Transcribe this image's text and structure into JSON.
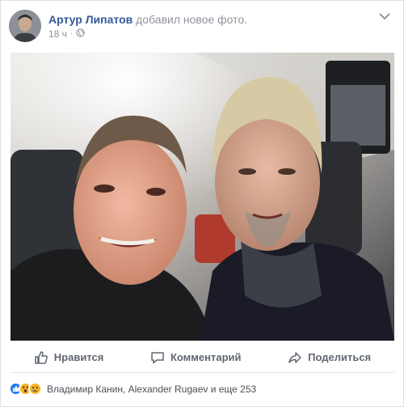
{
  "post": {
    "author": "Артур Липатов",
    "action": "добавил новое фото.",
    "time": "18 ч",
    "privacy_icon": "globe-icon",
    "more_icon": "chevron-down-icon"
  },
  "actions": {
    "like_label": "Нравится",
    "comment_label": "Комментарий",
    "share_label": "Поделиться"
  },
  "reactions": {
    "icons": [
      "like-reaction-icon",
      "wow-reaction-icon",
      "sad-reaction-icon"
    ],
    "summary": "Владимир Канин, Alexander Rugaev и еще 253"
  },
  "colors": {
    "name": "#365899",
    "muted": "#90949c",
    "action_text": "#606770",
    "like": "#2078f4",
    "emoji": "#f7b125"
  }
}
